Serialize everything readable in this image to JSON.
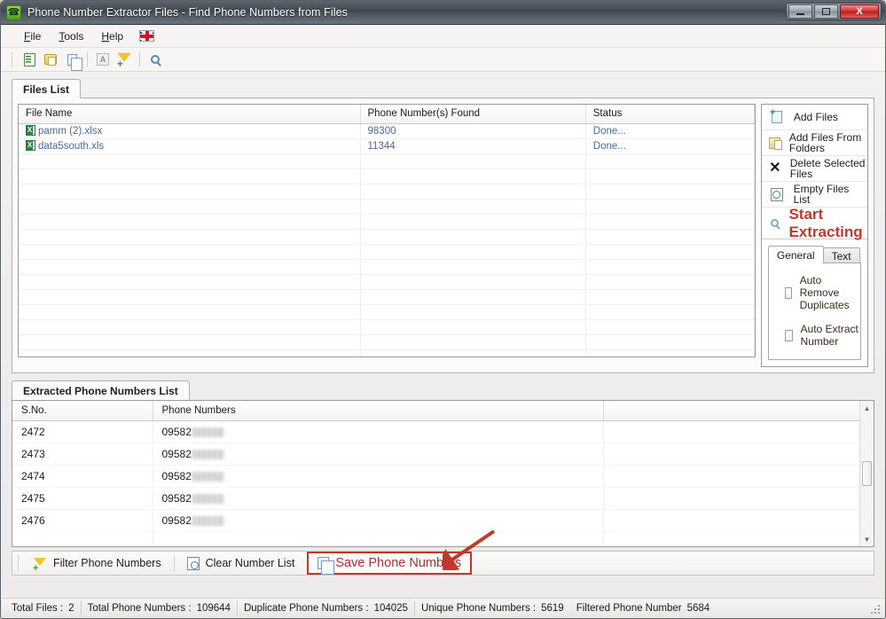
{
  "window": {
    "title": "Phone Number Extractor Files - Find Phone Numbers from Files",
    "app_icon": "phone-icon",
    "minimize_label": "Minimize",
    "maximize_label": "Maximize",
    "close_label": "X"
  },
  "menu": {
    "items": [
      {
        "label": "File",
        "accel": "F"
      },
      {
        "label": "Tools",
        "accel": "T"
      },
      {
        "label": "Help",
        "accel": "H"
      }
    ],
    "language_flag": "uk-flag-icon"
  },
  "toolbar": {
    "buttons": [
      {
        "name": "add-files-icon",
        "title": "Add Files"
      },
      {
        "name": "add-folder-icon",
        "title": "Add Files From Folders"
      },
      {
        "name": "copy-icon",
        "title": "Copy"
      },
      {
        "name": "text-a-icon",
        "title": "Text"
      },
      {
        "name": "filter-add-icon",
        "title": "Filter"
      },
      {
        "name": "search-icon",
        "title": "Search"
      }
    ]
  },
  "files_tab": {
    "label": "Files List",
    "columns": [
      "File Name",
      "Phone Number(s) Found",
      "Status"
    ],
    "rows": [
      {
        "file_name": "pamm (2).xlsx",
        "found": "98300",
        "status": "Done..."
      },
      {
        "file_name": "data5south.xls",
        "found": "11344",
        "status": "Done..."
      }
    ],
    "empty_rows": 14
  },
  "actions": {
    "items": [
      {
        "label": "Add Files",
        "icon": "add-file-icon"
      },
      {
        "label": "Add Files From Folders",
        "icon": "add-folder-icon"
      },
      {
        "label": "Delete Selected Files",
        "icon": "delete-x-icon"
      },
      {
        "label": "Empty Files List",
        "icon": "empty-list-icon"
      }
    ],
    "start_extracting": {
      "label": "Start Extracting",
      "icon": "magnifier-icon",
      "color": "#c0392b"
    }
  },
  "options": {
    "tabs": [
      {
        "label": "General",
        "active": true
      },
      {
        "label": "Text",
        "active": false
      }
    ],
    "checkboxes": [
      {
        "label": "Auto Remove Duplicates",
        "checked": false
      },
      {
        "label": "Auto Extract Number",
        "checked": false
      }
    ]
  },
  "extracted_tab": {
    "label": "Extracted Phone Numbers List",
    "columns": [
      "S.No.",
      "Phone Numbers",
      ""
    ],
    "rows": [
      {
        "sno": "2472",
        "number_prefix": "09582"
      },
      {
        "sno": "2473",
        "number_prefix": "09582"
      },
      {
        "sno": "2474",
        "number_prefix": "09582"
      },
      {
        "sno": "2475",
        "number_prefix": "09582"
      },
      {
        "sno": "2476",
        "number_prefix": "09582"
      }
    ]
  },
  "bottom_toolbar": {
    "filter_label": "Filter Phone Numbers",
    "clear_label": "Clear Number List",
    "save_label": "Save Phone Numbers",
    "highlight_color": "#c0392b"
  },
  "status_bar": {
    "total_files_label": "Total Files :",
    "total_files_value": "2",
    "total_numbers_label": "Total Phone Numbers :",
    "total_numbers_value": "109644",
    "duplicate_label": "Duplicate Phone Numbers :",
    "duplicate_value": "104025",
    "unique_label": "Unique Phone Numbers :",
    "unique_value": "5619",
    "filtered_label": "Filtered Phone Number",
    "filtered_value": "5684"
  }
}
